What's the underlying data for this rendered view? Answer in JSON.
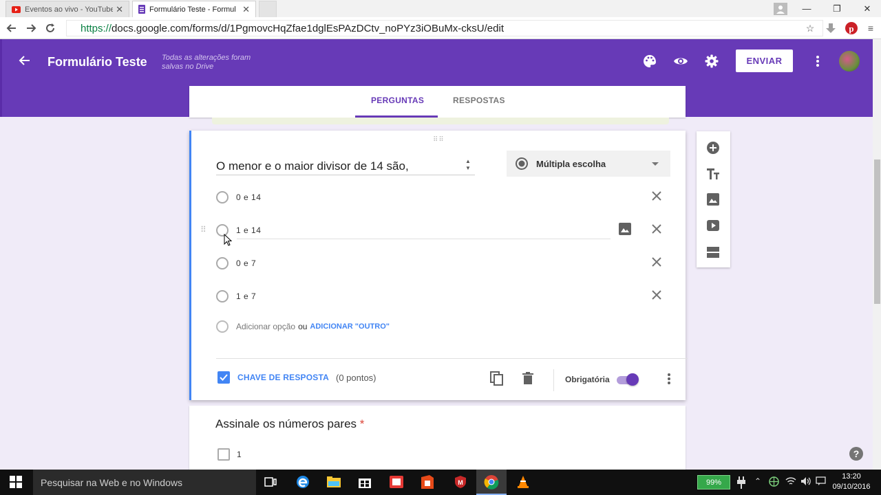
{
  "browser": {
    "tabs": [
      {
        "title": "Eventos ao vivo - YouTube"
      },
      {
        "title": "Formulário Teste - Formul"
      }
    ],
    "url_scheme": "https://",
    "url_rest": "docs.google.com/forms/d/1PgmovcHqZfae1dglEsPAzDCtv_noPYz3iOBuMx-cksU/edit"
  },
  "header": {
    "title": "Formulário Teste",
    "saved_line1": "Todas as alterações foram",
    "saved_line2": "salvas no Drive",
    "send_label": "ENVIAR",
    "accent": "#673ab7"
  },
  "form_tabs": [
    {
      "label": "PERGUNTAS",
      "active": true
    },
    {
      "label": "RESPOSTAS",
      "active": false
    }
  ],
  "question": {
    "title": "O menor e o maior divisor de 14 são,",
    "type_label": "Múltipla escolha",
    "options": [
      "0 e 14",
      "1 e 14",
      "0 e 7",
      "1 e 7"
    ],
    "add_option": "Adicionar opção",
    "or": "ou",
    "add_other": "ADICIONAR \"OUTRO\"",
    "answer_key_label": "CHAVE DE RESPOSTA",
    "points": "(0 pontos)",
    "required_label": "Obrigatória",
    "required": true
  },
  "question2": {
    "title": "Assinale os números pares",
    "required_mark": "*",
    "options": [
      "1"
    ]
  },
  "side_toolbar": [
    "add-question-icon",
    "title-icon",
    "image-icon",
    "video-icon",
    "section-icon"
  ],
  "taskbar": {
    "search_placeholder": "Pesquisar na Web e no Windows",
    "battery": "99%",
    "time": "13:20",
    "date": "09/10/2016"
  }
}
